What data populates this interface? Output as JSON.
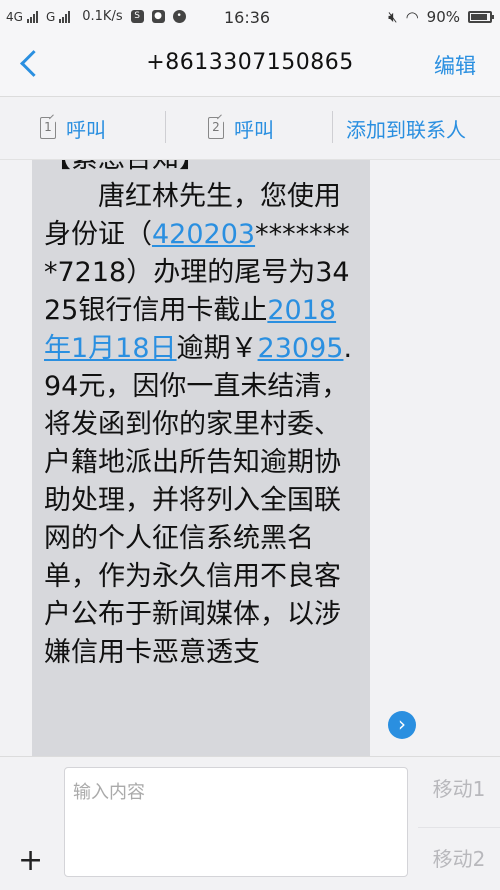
{
  "status_bar": {
    "network1": "4G",
    "network2": "G",
    "speed": "0.1K/s",
    "time": "16:36",
    "battery": "90%",
    "battery_level": 0.9
  },
  "header": {
    "back_icon": "chevron-left-icon",
    "title": "+8613307150865",
    "edit_label": "编辑"
  },
  "actions": {
    "call1_sim": "1",
    "call1_label": "呼叫",
    "call2_sim": "2",
    "call2_label": "呼叫",
    "add_contact_label": "添加到联系人"
  },
  "message": {
    "heading": "【紧急告知】",
    "p1": "　　唐红林先生，您使用身份证（",
    "id_prefix": "420203",
    "p2": "********7218）办理的尾号为3425银行信用卡截止",
    "date": "2018年1月18日",
    "p3": "逾期￥",
    "amount": "23095",
    "p4": ".94元，因你一直未结清，将发函到你的家里村委、户籍地派出所告知逾期协助处理，并将列入全国联网的个人征信系统黑名单，作为永久信用不良客户公布于新闻媒体，以涉嫌信用卡恶意透支"
  },
  "input": {
    "placeholder": "输入内容",
    "plus": "+",
    "send1_label": "移动1",
    "send2_label": "移动2"
  },
  "colors": {
    "accent": "#2a8fe0",
    "bubble": "#d7d8dc"
  }
}
